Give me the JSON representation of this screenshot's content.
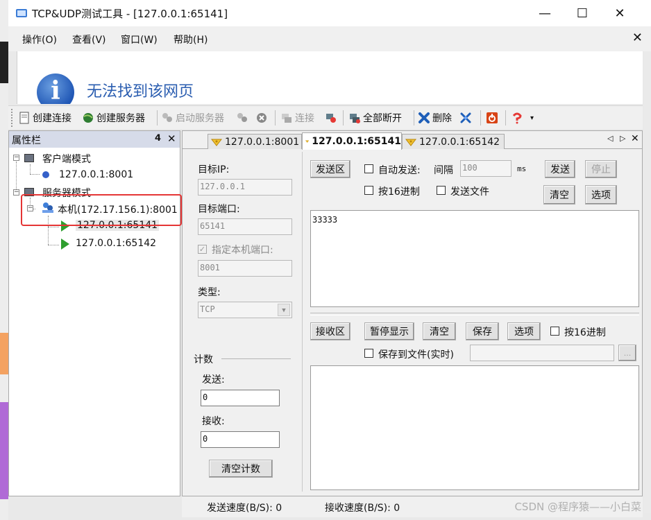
{
  "window": {
    "title": "TCP&UDP测试工具 - [127.0.0.1:65141]",
    "minimize": "—",
    "maximize": "☐",
    "close": "✕"
  },
  "menu": {
    "items": [
      "操作(O)",
      "查看(V)",
      "窗口(W)",
      "帮助(H)"
    ],
    "mdi_close": "✕"
  },
  "error_page": {
    "title": "无法找到该网页"
  },
  "toolbar": {
    "create_connection": "创建连接",
    "create_server": "创建服务器",
    "start_server": "启动服务器",
    "connect": "连接",
    "disconnect_all": "全部断开",
    "delete": "删除"
  },
  "property_panel": {
    "title": "属性栏",
    "pin": "ㅁ",
    "close": "✕",
    "tree": {
      "client_mode": "客户端模式",
      "client_conn": "127.0.0.1:8001",
      "server_mode": "服务器模式",
      "local_server": "本机(172.17.156.1):8001",
      "server_conn_1": "127.0.0.1:65141",
      "server_conn_2": "127.0.0.1:65142"
    }
  },
  "tabs": {
    "items": [
      "127.0.0.1:8001",
      "127.0.0.1:65141",
      "127.0.0.1:65142"
    ],
    "active": 1,
    "nav_left": "◁",
    "nav_right": "▷",
    "close": "✕"
  },
  "settings": {
    "target_ip_label": "目标IP:",
    "target_ip": "127.0.0.1",
    "target_port_label": "目标端口:",
    "target_port": "65141",
    "local_port_label": "指定本机端口:",
    "local_port": "8001",
    "type_label": "类型:",
    "type_value": "TCP"
  },
  "counter": {
    "title": "计数",
    "send_label": "发送:",
    "send_value": "0",
    "recv_label": "接收:",
    "recv_value": "0",
    "clear_button": "清空计数"
  },
  "send_area": {
    "title": "发送区",
    "auto_send": "自动发送:",
    "interval_label": "间隔",
    "interval_value": "100",
    "interval_unit": "ms",
    "send_button": "发送",
    "stop_button": "停止",
    "hex_label": "按16进制",
    "send_file_label": "发送文件",
    "clear_button": "清空",
    "options_button": "选项",
    "content": "33333"
  },
  "recv_area": {
    "title": "接收区",
    "pause_button": "暂停显示",
    "clear_button": "清空",
    "save_button": "保存",
    "options_button": "选项",
    "hex_label": "按16进制",
    "save_to_file_label": "保存到文件(实时)",
    "browse_button": "..."
  },
  "status": {
    "send_speed": "发送速度(B/S): 0",
    "recv_speed": "接收速度(B/S): 0"
  },
  "watermark": "CSDN @程序猿——小白菜",
  "colors": {
    "accent_blue": "#2a5db0",
    "highlight_red": "#e53535",
    "panel_header": "#d6dbe9"
  }
}
